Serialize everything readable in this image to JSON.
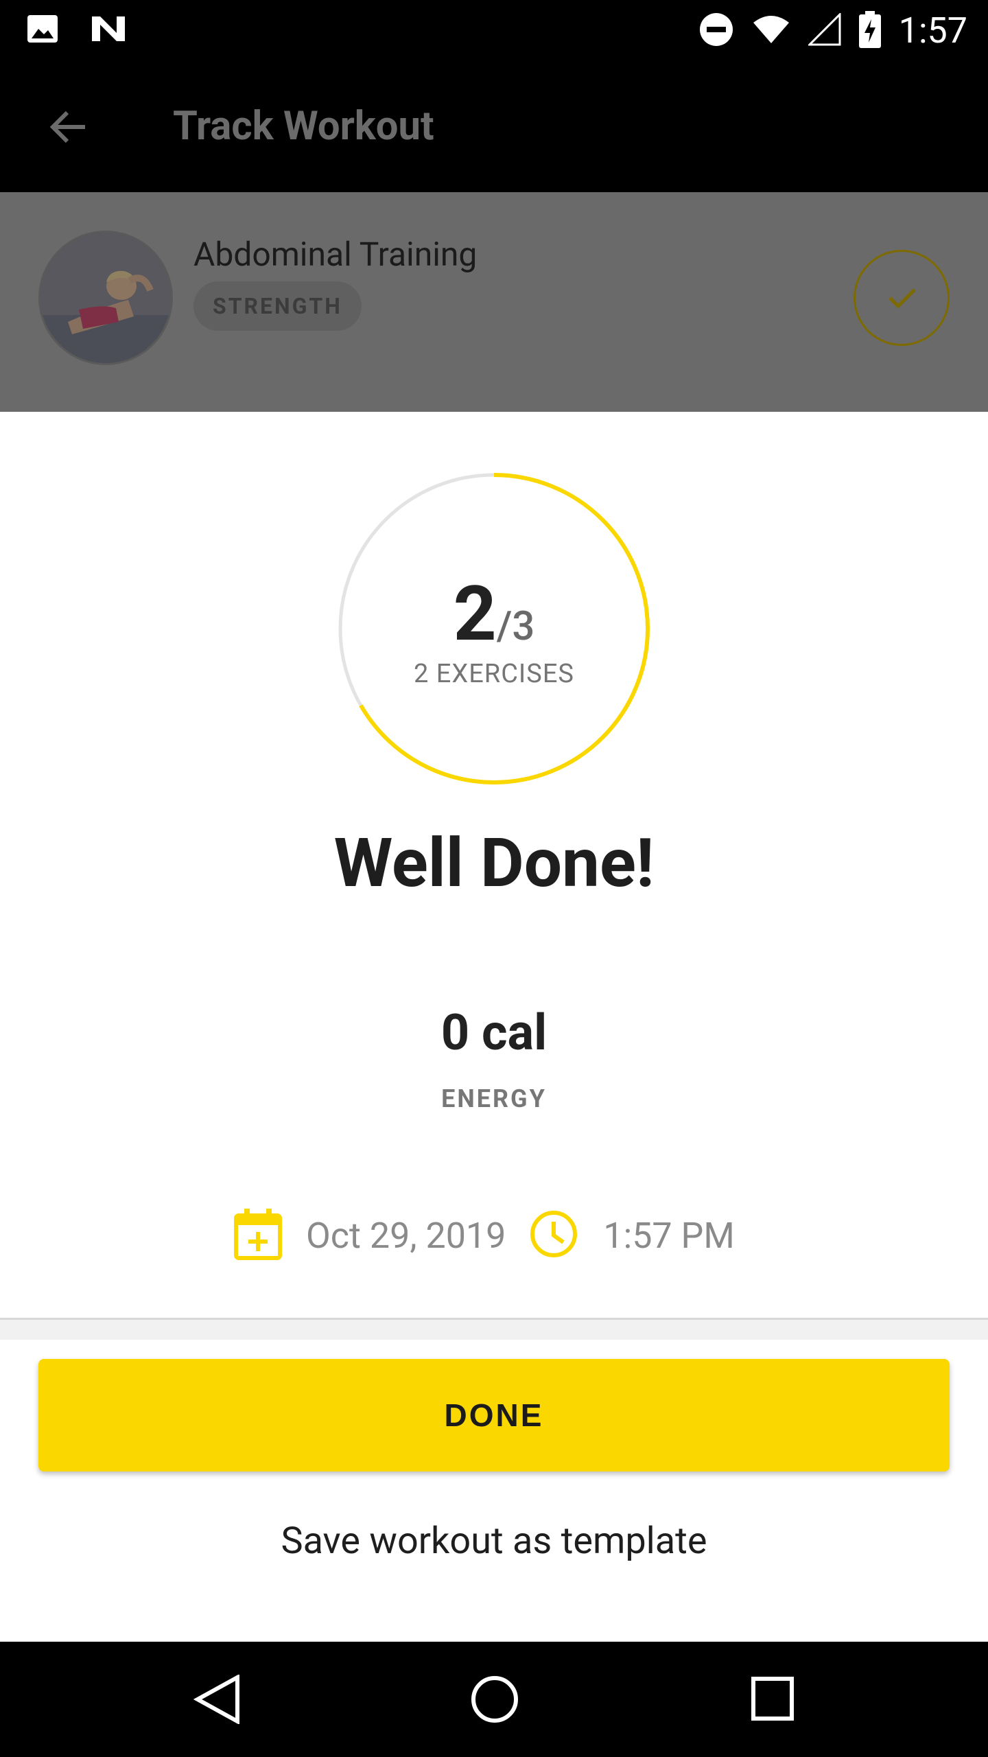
{
  "status_bar": {
    "time": "1:57"
  },
  "app_bar": {
    "title": "Track Workout"
  },
  "workout": {
    "name": "Abdominal Training",
    "category": "STRENGTH"
  },
  "progress": {
    "completed": "2",
    "total": "/3",
    "fraction": 0.6667,
    "label": "2 EXERCISES"
  },
  "headline": "Well Done!",
  "energy": {
    "value": "0 cal",
    "label": "ENERGY"
  },
  "meta": {
    "date": "Oct 29, 2019",
    "time": "1:57 PM"
  },
  "actions": {
    "done_label": "DONE",
    "template_label": "Save workout as template"
  },
  "colors": {
    "accent": "#fbd700",
    "dark": "#000000"
  }
}
